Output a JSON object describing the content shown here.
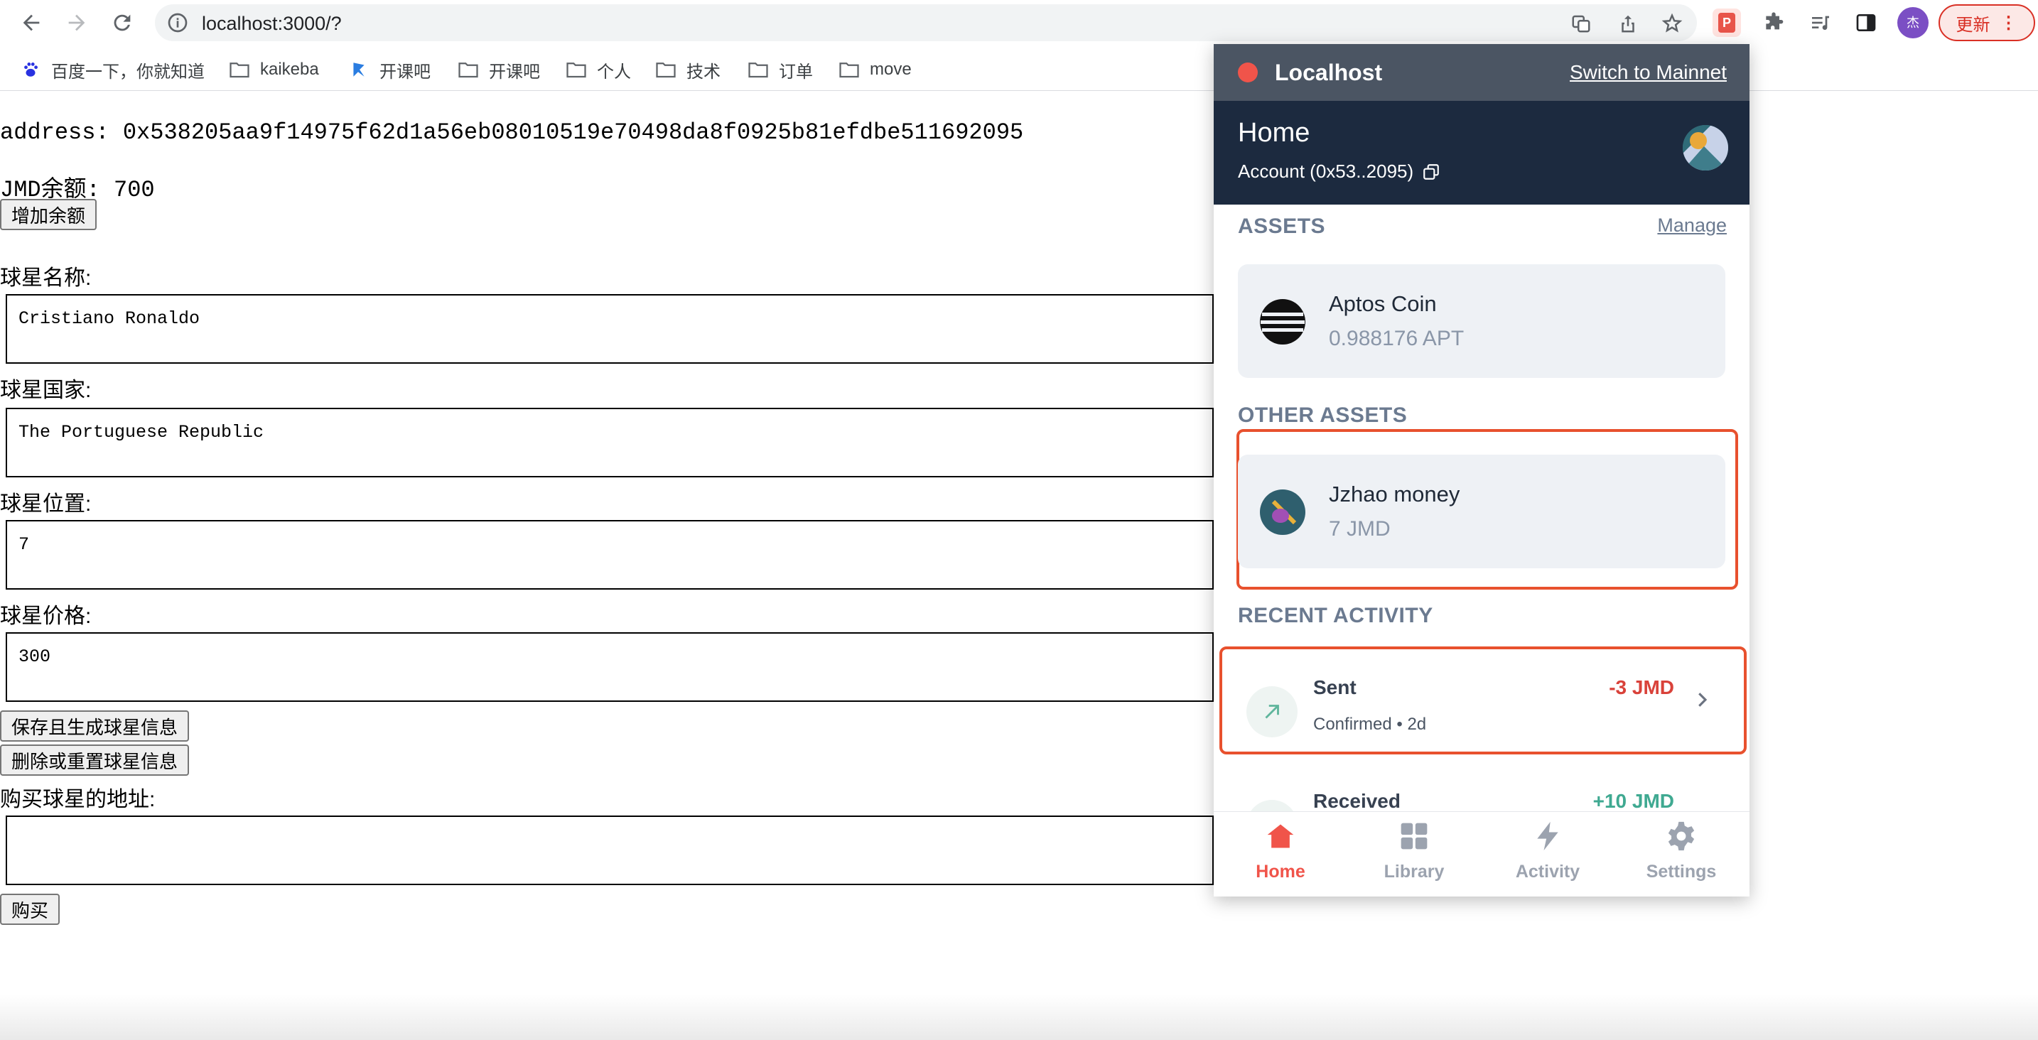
{
  "browser": {
    "url": "localhost:3000/?",
    "update_label": "更新",
    "user_avatar": "杰"
  },
  "bookmarks": [
    {
      "label": "百度一下，你就知道",
      "icon": "baidu-icon"
    },
    {
      "label": "kaikeba",
      "icon": "folder-icon"
    },
    {
      "label": "开课吧",
      "icon": "kaikeba-logo-icon"
    },
    {
      "label": "开课吧",
      "icon": "folder-icon"
    },
    {
      "label": "个人",
      "icon": "folder-icon"
    },
    {
      "label": "技术",
      "icon": "folder-icon"
    },
    {
      "label": "订单",
      "icon": "folder-icon"
    },
    {
      "label": "move",
      "icon": "folder-icon"
    }
  ],
  "page": {
    "address_line": "address: 0x538205aa9f14975f62d1a56eb08010519e70498da8f0925b81efdbe511692095",
    "balance_line": "JMD余额: 700",
    "add_balance_button": "增加余额",
    "name_label": "球星名称:",
    "name_value": "Cristiano Ronaldo",
    "country_label": "球星国家:",
    "country_value": "The Portuguese Republic",
    "position_label": "球星位置:",
    "position_value": "7",
    "price_label": "球星价格:",
    "price_value": "300",
    "save_button": "保存且生成球星信息",
    "delete_button": "删除或重置球星信息",
    "buyer_label": "购买球星的地址:",
    "buyer_value": "",
    "buy_button": "购买"
  },
  "wallet": {
    "network": "Localhost",
    "switch_link": "Switch to Mainnet",
    "title": "Home",
    "account": "Account (0x53..2095)",
    "assets_heading": "ASSETS",
    "manage_link": "Manage",
    "assets": [
      {
        "name": "Aptos Coin",
        "value": "0.988176 APT"
      }
    ],
    "other_assets_heading": "OTHER ASSETS",
    "other_assets": [
      {
        "name": "Jzhao money",
        "value": "7 JMD"
      }
    ],
    "recent_heading": "RECENT ACTIVITY",
    "activity": [
      {
        "title": "Sent",
        "status": "Confirmed • 2d",
        "amount": "-3 JMD",
        "amount_color": "#d9423a"
      },
      {
        "title": "Received",
        "status": "",
        "amount": "+10 JMD",
        "amount_color": "#3fa991"
      }
    ],
    "nav": [
      {
        "label": "Home",
        "icon": "home-icon",
        "active": true
      },
      {
        "label": "Library",
        "icon": "grid-icon",
        "active": false
      },
      {
        "label": "Activity",
        "icon": "bolt-icon",
        "active": false
      },
      {
        "label": "Settings",
        "icon": "gear-icon",
        "active": false
      }
    ],
    "colors": {
      "accent": "#f0544a",
      "header": "#1c2a3f",
      "network_bar": "#4b5563",
      "highlight": "#e8512e"
    }
  }
}
